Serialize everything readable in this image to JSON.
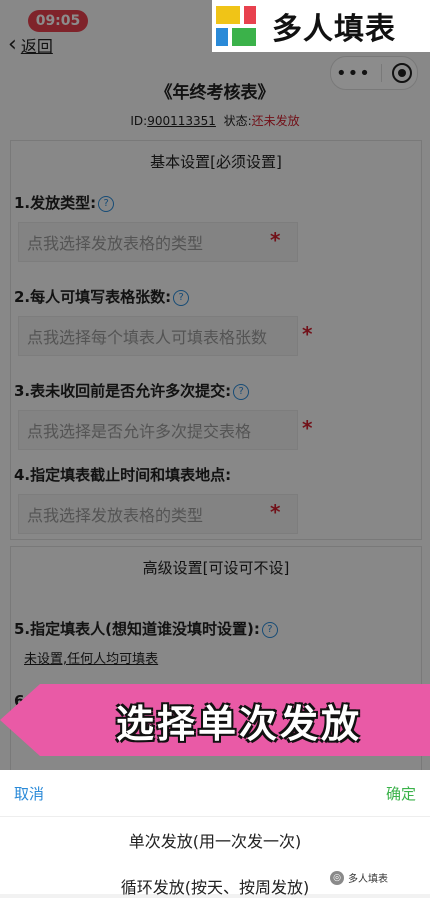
{
  "status_bar": {
    "time": "09:05"
  },
  "nav": {
    "back_label": "返回"
  },
  "brand": {
    "name": "多人填表",
    "colors": [
      "#f0c417",
      "#e8414e",
      "#2a8ad8",
      "#3bb24a"
    ]
  },
  "form": {
    "title": "《年终考核表》",
    "id_label": "ID:",
    "id_value": "900113351",
    "status_label": "状态:",
    "status_value": "还未发放"
  },
  "basic_section": {
    "header": "基本设置[必须设置]",
    "questions": [
      {
        "label": "1.发放类型:",
        "placeholder": "点我选择发放表格的类型"
      },
      {
        "label": "2.每人可填写表格张数:",
        "placeholder": "点我选择每个填表人可填表格张数"
      },
      {
        "label": "3.表未收回前是否允许多次提交:",
        "placeholder": "点我选择是否允许多次提交表格"
      },
      {
        "label": "4.指定填表截止时间和填表地点:",
        "placeholder": "点我选择发放表格的类型"
      }
    ],
    "required_mark": "*",
    "help_icon": "?"
  },
  "advanced_section": {
    "header": "高级设置[可设可不设]",
    "q5_label": "5.指定填表人(想知道谁没填时设置):",
    "q5_value": "未设置,任何人均可填表",
    "q6_label": "6.表"
  },
  "banner": {
    "text": "选择单次发放",
    "color": "#e95aa6"
  },
  "sheet": {
    "cancel": "取消",
    "confirm": "确定",
    "options": [
      "单次发放(用一次发一次)",
      "循环发放(按天、按周发放)"
    ]
  },
  "watermark": {
    "text": "多人填表"
  }
}
